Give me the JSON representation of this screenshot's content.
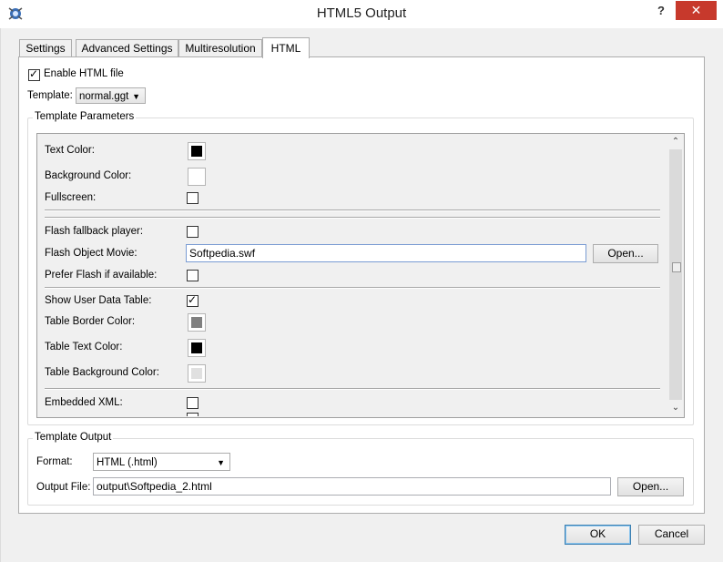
{
  "window": {
    "title": "HTML5 Output",
    "help_label": "?",
    "close_label": "✕"
  },
  "tabs": [
    {
      "label": "Settings",
      "active": false
    },
    {
      "label": "Advanced Settings",
      "active": false
    },
    {
      "label": "Multiresolution",
      "active": false
    },
    {
      "label": "HTML",
      "active": true
    }
  ],
  "html_tab": {
    "enable_label": "Enable HTML file",
    "enable_checked": true,
    "template_label": "Template:",
    "template_value": "normal.ggt",
    "params_title": "Template Parameters",
    "params": {
      "text_color_label": "Text Color:",
      "text_color": "#000000",
      "background_color_label": "Background Color:",
      "background_color": "#ffffff",
      "fullscreen_label": "Fullscreen:",
      "fullscreen_checked": false,
      "flash_fallback_label": "Flash fallback player:",
      "flash_fallback_checked": false,
      "flash_movie_label": "Flash Object Movie:",
      "flash_movie_value": "Softpedia.swf",
      "flash_open_label": "Open...",
      "prefer_flash_label": "Prefer Flash if available:",
      "prefer_flash_checked": false,
      "show_table_label": "Show User Data Table:",
      "show_table_checked": true,
      "table_border_label": "Table Border Color:",
      "table_border_color": "#808080",
      "table_text_label": "Table Text Color:",
      "table_text_color": "#000000",
      "table_bg_label": "Table Background Color:",
      "table_bg_color": "#e0e0e0",
      "embedded_xml_label": "Embedded XML:",
      "embedded_xml_checked": false
    },
    "output_title": "Template Output",
    "format_label": "Format:",
    "format_value": "HTML (.html)",
    "output_file_label": "Output File:",
    "output_file_value": "output\\Softpedia_2.html",
    "output_open_label": "Open..."
  },
  "footer": {
    "ok_label": "OK",
    "cancel_label": "Cancel"
  },
  "icons": {
    "dropdown": "▼",
    "scroll_up": "⌃",
    "scroll_down": "⌄"
  }
}
